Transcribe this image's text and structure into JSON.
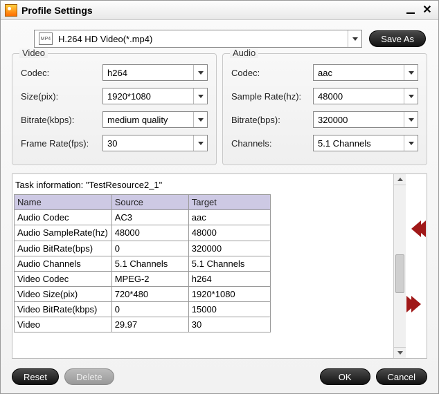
{
  "title": "Profile Settings",
  "profile_icon_text": "MP4",
  "profile_label": "H.264 HD Video(*.mp4)",
  "save_as": "Save As",
  "video": {
    "title": "Video",
    "codec_label": "Codec:",
    "codec": "h264",
    "size_label": "Size(pix):",
    "size": "1920*1080",
    "bitrate_label": "Bitrate(kbps):",
    "bitrate": "medium quality",
    "fps_label": "Frame Rate(fps):",
    "fps": "30"
  },
  "audio": {
    "title": "Audio",
    "codec_label": "Codec:",
    "codec": "aac",
    "sr_label": "Sample Rate(hz):",
    "sr": "48000",
    "bitrate_label": "Bitrate(bps):",
    "bitrate": "320000",
    "channels_label": "Channels:",
    "channels": "5.1 Channels"
  },
  "task": {
    "heading": "Task information: \"TestResource2_1\"",
    "headers": {
      "name": "Name",
      "source": "Source",
      "target": "Target"
    },
    "rows": [
      {
        "name": "Audio Codec",
        "source": "AC3",
        "target": "aac"
      },
      {
        "name": "Audio SampleRate(hz)",
        "source": "48000",
        "target": "48000"
      },
      {
        "name": "Audio BitRate(bps)",
        "source": "0",
        "target": "320000"
      },
      {
        "name": "Audio Channels",
        "source": "5.1 Channels",
        "target": "5.1 Channels"
      },
      {
        "name": "Video Codec",
        "source": "MPEG-2",
        "target": "h264"
      },
      {
        "name": "Video Size(pix)",
        "source": "720*480",
        "target": "1920*1080"
      },
      {
        "name": "Video BitRate(kbps)",
        "source": "0",
        "target": "15000"
      },
      {
        "name": "Video",
        "source": "29.97",
        "target": "30"
      }
    ]
  },
  "buttons": {
    "reset": "Reset",
    "delete": "Delete",
    "ok": "OK",
    "cancel": "Cancel"
  }
}
